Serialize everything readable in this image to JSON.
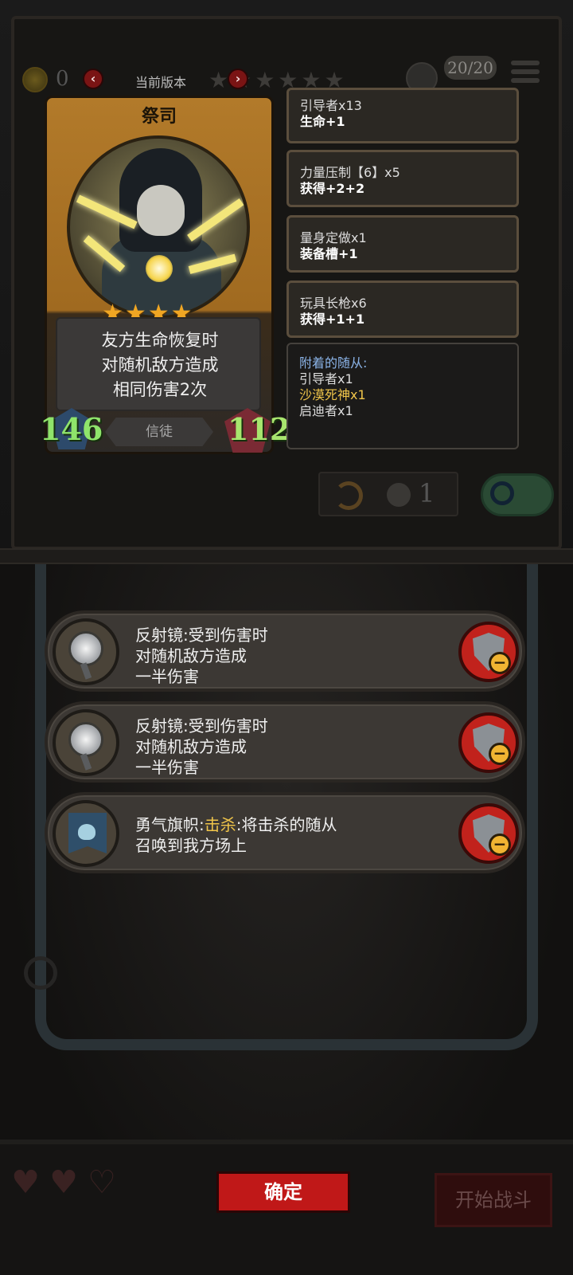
{
  "topbar": {
    "coins": "0",
    "version_label": "当前版本",
    "stars": "★★★★★★",
    "tier_count": "20/20"
  },
  "minion": {
    "name": "祭司",
    "rank_stars": "★★★★",
    "ability_lines": [
      "友方生命恢复时",
      "对随机敌方造成",
      "相同伤害2次"
    ],
    "tribe": "信徒",
    "attack": "146",
    "health": "112"
  },
  "info_panels": [
    {
      "title": "引导者x13",
      "effect": "生命+1"
    },
    {
      "title": "力量压制【6】x5",
      "effect": "获得+2+2"
    },
    {
      "title": "量身定做x1",
      "effect": "装备槽+1"
    },
    {
      "title": "玩具长枪x6",
      "effect": "获得+1+1"
    }
  ],
  "attached_minions": {
    "header": "附着的随从:",
    "items": [
      "引导者x1",
      "沙漠死神x1",
      "启迪者x1"
    ]
  },
  "refresh": {
    "cost": "1"
  },
  "equipment": [
    {
      "icon": "mirror-icon",
      "name": "反射镜",
      "lines": [
        "反射镜:受到伤害时",
        "对随机敌方造成",
        "一半伤害"
      ]
    },
    {
      "icon": "mirror-icon",
      "name": "反射镜",
      "lines": [
        "反射镜:受到伤害时",
        "对随机敌方造成",
        "一半伤害"
      ]
    },
    {
      "icon": "banner-icon",
      "name": "勇气旗帜",
      "prefix": "勇气旗帜:",
      "keyword": "击杀",
      "rest": ":将击杀的随从",
      "line2": "召唤到我方场上"
    }
  ],
  "buttons": {
    "confirm": "确定",
    "start_battle": "开始战斗"
  },
  "hearts": [
    "♥",
    "♥",
    "♡"
  ],
  "colors": {
    "confirm_bg": "#c01818",
    "remove_bg": "#c1221c",
    "attack_color": "#8fe46b",
    "highlight": "#f0c54a",
    "rarity_frame": "#b27a2a"
  }
}
